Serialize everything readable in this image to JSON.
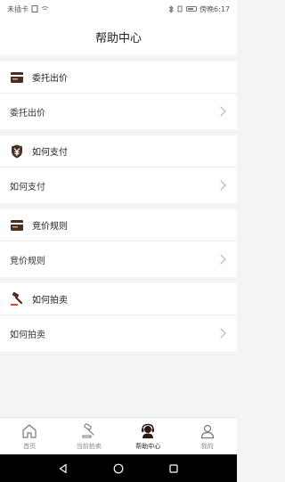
{
  "status_bar": {
    "carrier": "未插卡",
    "time": "傍晚6:17"
  },
  "header": {
    "title": "帮助中心"
  },
  "sections": [
    {
      "title": "委托出价",
      "row": "委托出价",
      "icon": "card-icon"
    },
    {
      "title": "如何支付",
      "row": "如何支付",
      "icon": "yen-shield-icon"
    },
    {
      "title": "竞价规则",
      "row": "竞价规则",
      "icon": "card-icon"
    },
    {
      "title": "如何拍卖",
      "row": "如何拍卖",
      "icon": "gavel-icon"
    }
  ],
  "tabs": [
    {
      "label": "首页",
      "icon": "home-icon",
      "active": false
    },
    {
      "label": "当前拍卖",
      "icon": "gavel-icon",
      "active": false
    },
    {
      "label": "帮助中心",
      "icon": "support-icon",
      "active": true
    },
    {
      "label": "我的",
      "icon": "user-icon",
      "active": false
    }
  ],
  "colors": {
    "accent": "#4a2e22",
    "background": "#f4f4f4"
  }
}
